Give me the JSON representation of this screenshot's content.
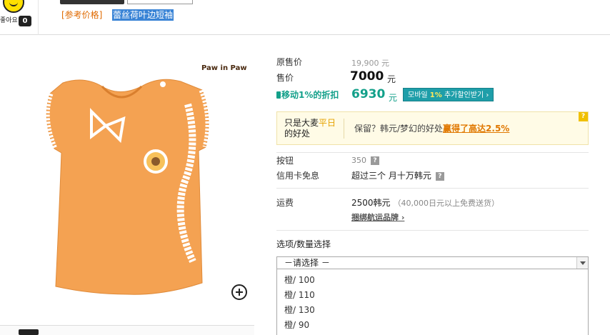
{
  "header": {
    "like_label": "좋아요",
    "like_count": "0",
    "ref_price_label": "[参考价格]",
    "ref_price_desc": "蕾丝荷叶边短袖"
  },
  "image": {
    "brand_logo": "Paw in Paw"
  },
  "price": {
    "original_label": "原售价",
    "original_value": "19,900 元",
    "sale_label": "售价",
    "sale_value": "7000",
    "sale_unit": "元",
    "mobile_label": "移动1%的折扣",
    "mobile_value": "6930",
    "mobile_unit": "元",
    "mobile_btn_prefix": "모바일 ",
    "mobile_btn_highlight": "1%",
    "mobile_btn_suffix": " 추가할인받기 ›"
  },
  "promo": {
    "left_a": "只是大麦",
    "left_highlight": "平日",
    "left_b": "的好处",
    "right_text": "保留？韩元/梦幻的好处",
    "right_link": "赢得了高达2.5%",
    "help": "?"
  },
  "points": {
    "label": "按钮",
    "value": "350",
    "help": "?"
  },
  "card": {
    "label": "信用卡免息",
    "value": "超过三个 月十万韩元",
    "help": "?"
  },
  "shipping": {
    "label": "运费",
    "value": "2500韩元",
    "note": "（40,000日元以上免费送货）",
    "link": "捆绑航运品牌 ›"
  },
  "options": {
    "label": "选项/数量选择",
    "placeholder": "－请选择 －",
    "items": [
      "橙/ 100",
      "橙/ 110",
      "橙/ 130",
      "橙/ 90"
    ]
  }
}
